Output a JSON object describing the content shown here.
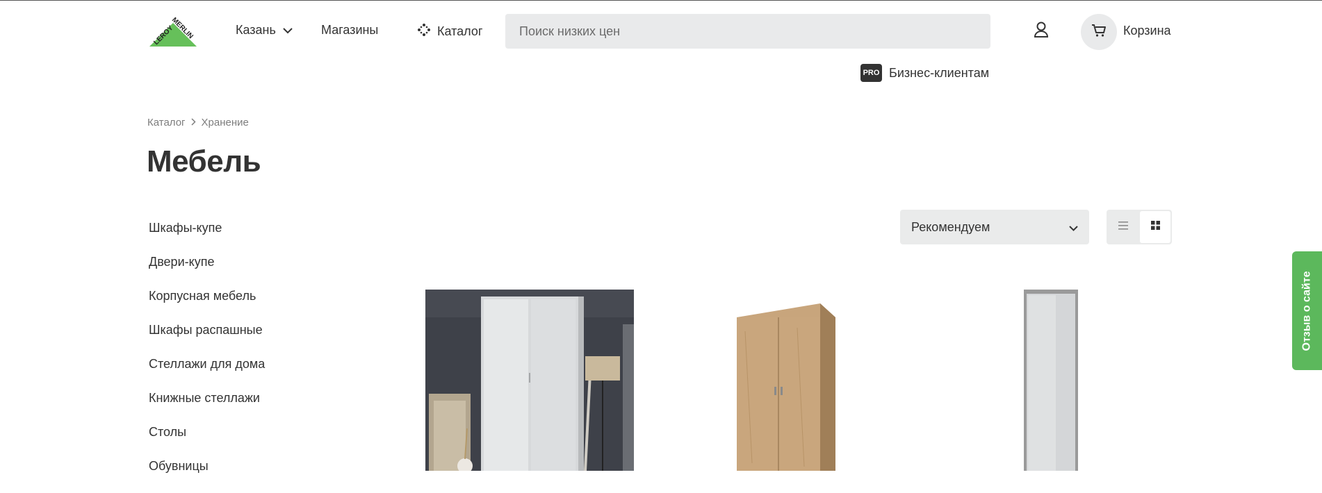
{
  "header": {
    "logo_text_left": "LEROY",
    "logo_text_right": "MERLIN",
    "city": "Казань",
    "shops": "Магазины",
    "catalog": "Каталог",
    "search_placeholder": "Поиск низких цен",
    "cart": "Корзина",
    "pro_badge": "PRO",
    "pro_label": "Бизнес-клиентам"
  },
  "breadcrumb": [
    "Каталог",
    "Хранение"
  ],
  "page_title": "Мебель",
  "sidebar": {
    "items": [
      "Шкафы-купе",
      "Двери-купе",
      "Корпусная мебель",
      "Шкафы распашные",
      "Стеллажи для дома",
      "Книжные стеллажи",
      "Столы",
      "Обувницы"
    ]
  },
  "sort": {
    "selected": "Рекомендуем"
  },
  "view": {
    "active": "grid"
  },
  "feedback": {
    "label": "Отзыв о сайте"
  },
  "colors": {
    "brand_green": "#66c05a",
    "feedback_green": "#5cb85c",
    "text": "#333333",
    "muted": "#7d7d7d",
    "control_bg": "#e9eaeb"
  },
  "icons": [
    "chevron-down-icon",
    "catalog-dots-icon",
    "user-icon",
    "cart-icon",
    "chevron-right-icon",
    "list-view-icon",
    "grid-view-icon"
  ]
}
